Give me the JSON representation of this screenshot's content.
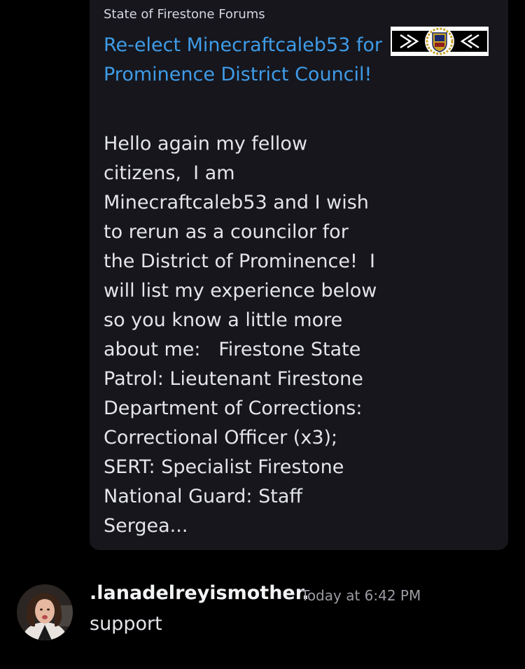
{
  "embed": {
    "provider": "State of Firestone Forums",
    "title": "Re-elect Minecraftcaleb53 for Prominence District Council!",
    "description": "Hello again my fellow citizens,  I am Minecraftcaleb53 and I wish to rerun as a councilor for the District of Prominence!  I will list my experience below so you know a little more about me:   Firestone State Patrol: Lieutenant Firestone Department of Corrections: Correctional Officer (x3); SERT: Specialist Firestone National Guard: Staff Sergea...",
    "thumbnail_icon": "firestone-seal-banner",
    "title_color": "#3f9ce8",
    "background_color": "#16161c"
  },
  "message": {
    "username": ".lanadelreyismother.",
    "timestamp": "Today at 6:42 PM",
    "text": "support",
    "avatar_icon": "user-avatar"
  }
}
